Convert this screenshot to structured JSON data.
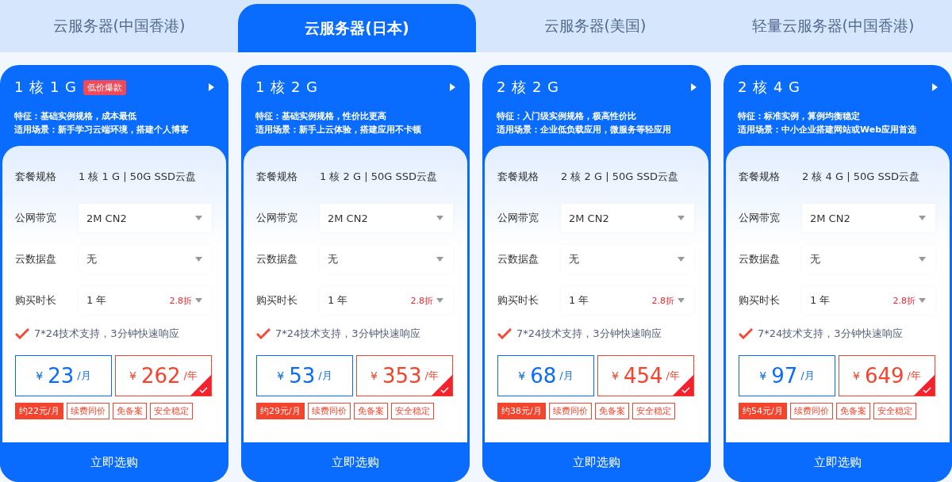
{
  "tabs": [
    {
      "label": "云服务器(中国香港)",
      "selected": false
    },
    {
      "label": "云服务器(日本)",
      "selected": true
    },
    {
      "label": "云服务器(美国)",
      "selected": false
    },
    {
      "label": "轻量云服务器(中国香港)",
      "selected": false
    }
  ],
  "plans": [
    {
      "name": "1 核 1 G",
      "badge": "低价爆款",
      "feature": "特征：基础实例规格，成本最低",
      "scene": "适用场景：新手学习云端环境，搭建个人博客",
      "rows": [
        {
          "kind": "text",
          "label": "套餐规格",
          "value": "1 核 1 G | 50G SSD云盘"
        },
        {
          "kind": "select",
          "label": "公网带宽",
          "value": "2M CN2"
        },
        {
          "kind": "select",
          "label": "云数据盘",
          "value": "无"
        },
        {
          "kind": "select",
          "label": "购买时长",
          "value": "1 年",
          "discount": "2.8折"
        }
      ],
      "support": "7*24技术支持，3分钟快速响应",
      "prices": [
        {
          "currency": "¥",
          "amount": "23",
          "unit": "/月",
          "selected": false
        },
        {
          "currency": "¥",
          "amount": "262",
          "unit": "/年",
          "selected": true
        }
      ],
      "tags": [
        {
          "label": "约22元/月",
          "kind": "solid"
        },
        {
          "label": "续费同价",
          "kind": "outline"
        },
        {
          "label": "免备案",
          "kind": "outline"
        },
        {
          "label": "安全稳定",
          "kind": "outline"
        }
      ],
      "button": "立即选购"
    },
    {
      "name": "1 核 2 G",
      "feature": "特征：基础实例规格，性价比更高",
      "scene": "适用场景：新手上云体验，搭建应用不卡顿",
      "rows": [
        {
          "kind": "text",
          "label": "套餐规格",
          "value": "1 核 2 G | 50G SSD云盘"
        },
        {
          "kind": "select",
          "label": "公网带宽",
          "value": "2M CN2"
        },
        {
          "kind": "select",
          "label": "云数据盘",
          "value": "无"
        },
        {
          "kind": "select",
          "label": "购买时长",
          "value": "1 年",
          "discount": "2.8折"
        }
      ],
      "support": "7*24技术支持，3分钟快速响应",
      "prices": [
        {
          "currency": "¥",
          "amount": "53",
          "unit": "/月",
          "selected": false
        },
        {
          "currency": "¥",
          "amount": "353",
          "unit": "/年",
          "selected": true
        }
      ],
      "tags": [
        {
          "label": "约29元/月",
          "kind": "solid"
        },
        {
          "label": "续费同价",
          "kind": "outline"
        },
        {
          "label": "免备案",
          "kind": "outline"
        },
        {
          "label": "安全稳定",
          "kind": "outline"
        }
      ],
      "button": "立即选购"
    },
    {
      "name": "2 核 2 G",
      "feature": "特征：入门级实例规格，极高性价比",
      "scene": "适用场景：企业低负载应用，微服务等轻应用",
      "rows": [
        {
          "kind": "text",
          "label": "套餐规格",
          "value": "2 核 2 G | 50G SSD云盘"
        },
        {
          "kind": "select",
          "label": "公网带宽",
          "value": "2M CN2"
        },
        {
          "kind": "select",
          "label": "云数据盘",
          "value": "无"
        },
        {
          "kind": "select",
          "label": "购买时长",
          "value": "1 年",
          "discount": "2.8折"
        }
      ],
      "support": "7*24技术支持，3分钟快速响应",
      "prices": [
        {
          "currency": "¥",
          "amount": "68",
          "unit": "/月",
          "selected": false
        },
        {
          "currency": "¥",
          "amount": "454",
          "unit": "/年",
          "selected": true
        }
      ],
      "tags": [
        {
          "label": "约38元/月",
          "kind": "solid"
        },
        {
          "label": "续费同价",
          "kind": "outline"
        },
        {
          "label": "免备案",
          "kind": "outline"
        },
        {
          "label": "安全稳定",
          "kind": "outline"
        }
      ],
      "button": "立即选购"
    },
    {
      "name": "2 核 4 G",
      "feature": "特征：标准实例，算例均衡稳定",
      "scene": "适用场景：中小企业搭建网站或Web应用首选",
      "rows": [
        {
          "kind": "text",
          "label": "套餐规格",
          "value": "2 核 4 G | 50G SSD云盘"
        },
        {
          "kind": "select",
          "label": "公网带宽",
          "value": "2M CN2"
        },
        {
          "kind": "select",
          "label": "云数据盘",
          "value": "无"
        },
        {
          "kind": "select",
          "label": "购买时长",
          "value": "1 年",
          "discount": "2.8折"
        }
      ],
      "support": "7*24技术支持，3分钟快速响应",
      "prices": [
        {
          "currency": "¥",
          "amount": "97",
          "unit": "/月",
          "selected": false
        },
        {
          "currency": "¥",
          "amount": "649",
          "unit": "/年",
          "selected": true
        }
      ],
      "tags": [
        {
          "label": "约54元/月",
          "kind": "solid"
        },
        {
          "label": "续费同价",
          "kind": "outline"
        },
        {
          "label": "免备案",
          "kind": "outline"
        },
        {
          "label": "安全稳定",
          "kind": "outline"
        }
      ],
      "button": "立即选购"
    }
  ]
}
